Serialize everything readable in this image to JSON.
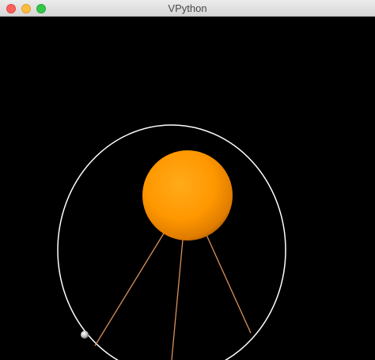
{
  "window": {
    "title": "VPython",
    "buttons": [
      "close",
      "minimize",
      "zoom"
    ]
  },
  "scene": {
    "background_color": "#000000",
    "ring_color": "#ffffff",
    "sun_color": "#ff9a00",
    "spoke_color": "#d98a4a",
    "planet_color": "#cfcfcf"
  }
}
